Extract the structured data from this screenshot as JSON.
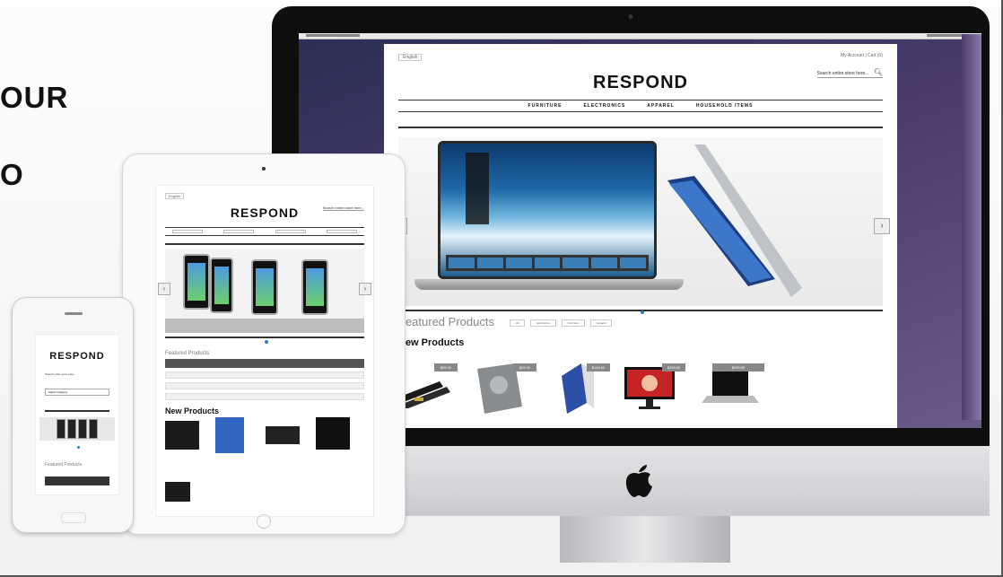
{
  "headline": {
    "line1": "OUR",
    "line2": "O"
  },
  "desktop_site": {
    "logo": "RESPOND",
    "language": "English",
    "top_links": "My Account | Cart (0)",
    "search_placeholder": "Search entire store here...",
    "nav": [
      "FURNITURE",
      "ELECTRONICS",
      "APPAREL",
      "HOUSEHOLD ITEMS"
    ],
    "featured_title": "Featured Products",
    "featured_tabs": [
      "All",
      "Electronics",
      "Furniture",
      "Apparel"
    ],
    "new_products_title": "New Products",
    "product_prices": [
      "$99.00",
      "$29.00",
      "$149.00",
      "$399.00",
      "$299.00"
    ],
    "slider_prev": "‹",
    "slider_next": "›"
  },
  "tablet_site": {
    "logo": "RESPOND",
    "language": "English",
    "search_placeholder": "Search entire store here...",
    "featured_title": "Featured Products",
    "new_products_title": "New Products",
    "slider_prev": "‹",
    "slider_next": "›"
  },
  "phone_site": {
    "logo": "RESPOND",
    "search_placeholder": "Search entire store here...",
    "category_select": "Select Category",
    "featured_title": "Featured Products"
  },
  "colors": {
    "accent_dot": "#2a7ec8",
    "text_dark": "#111111",
    "bar_grey": "#555555"
  },
  "icons": [
    "apple-logo-icon",
    "search-icon",
    "chevron-left-icon",
    "chevron-right-icon"
  ]
}
